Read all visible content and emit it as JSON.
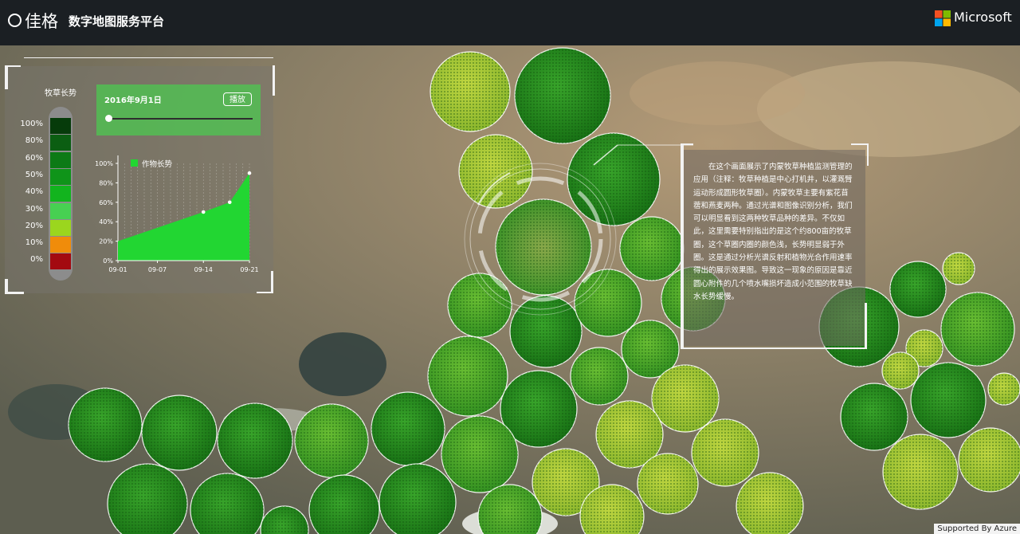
{
  "header": {
    "brand": "佳格",
    "title": "数字地图服务平台",
    "partner": "Microsoft"
  },
  "legend": {
    "title": "牧草长势",
    "levels": [
      {
        "label": "100%",
        "color": "#063b0a"
      },
      {
        "label": "80%",
        "color": "#0b5e12"
      },
      {
        "label": "60%",
        "color": "#0d7a16"
      },
      {
        "label": "50%",
        "color": "#0f9419"
      },
      {
        "label": "40%",
        "color": "#12b41e"
      },
      {
        "label": "30%",
        "color": "#47d052"
      },
      {
        "label": "20%",
        "color": "#9bd61e"
      },
      {
        "label": "10%",
        "color": "#f08c0a"
      },
      {
        "label": "0%",
        "color": "#a30a10"
      }
    ]
  },
  "timeline": {
    "date": "2016年9月1日",
    "play_label": "播放",
    "progress": 0
  },
  "chart_data": {
    "type": "area",
    "legend": "作物长势",
    "x": [
      "09-01",
      "09-07",
      "09-14",
      "09-21"
    ],
    "x_days": [
      1,
      7,
      14,
      21
    ],
    "points": [
      {
        "day": 1,
        "value": 20
      },
      {
        "day": 14,
        "value": 50
      },
      {
        "day": 18,
        "value": 60
      },
      {
        "day": 21,
        "value": 90
      }
    ],
    "y_ticks": [
      "0%",
      "20%",
      "40%",
      "60%",
      "80%",
      "100%"
    ],
    "ylim": [
      0,
      100
    ],
    "color": "#22d632",
    "grid": true
  },
  "info": {
    "text": "在这个画面展示了内蒙牧草种植监测管理的应用（注释：牧草种植是中心打机井，以灌溉臂运动形成圆形牧草圈）。内蒙牧草主要有紫花苜蓿和燕麦两种。通过光谱和图像识别分析，我们可以明显看到这两种牧草品种的差异。不仅如此，这里需要特别指出的是这个约800亩的牧草圈，这个草圈内圈的颜色浅，长势明显弱于外圈。这是通过分析光谱反射和植物光合作用速率得出的展示效果图。导致这一现象的原因是靠近圆心附件的几个喷水嘴损坏造成小范围的牧草缺水长势缓慢。"
  },
  "footer": {
    "attribution": "Supported By Azure"
  }
}
